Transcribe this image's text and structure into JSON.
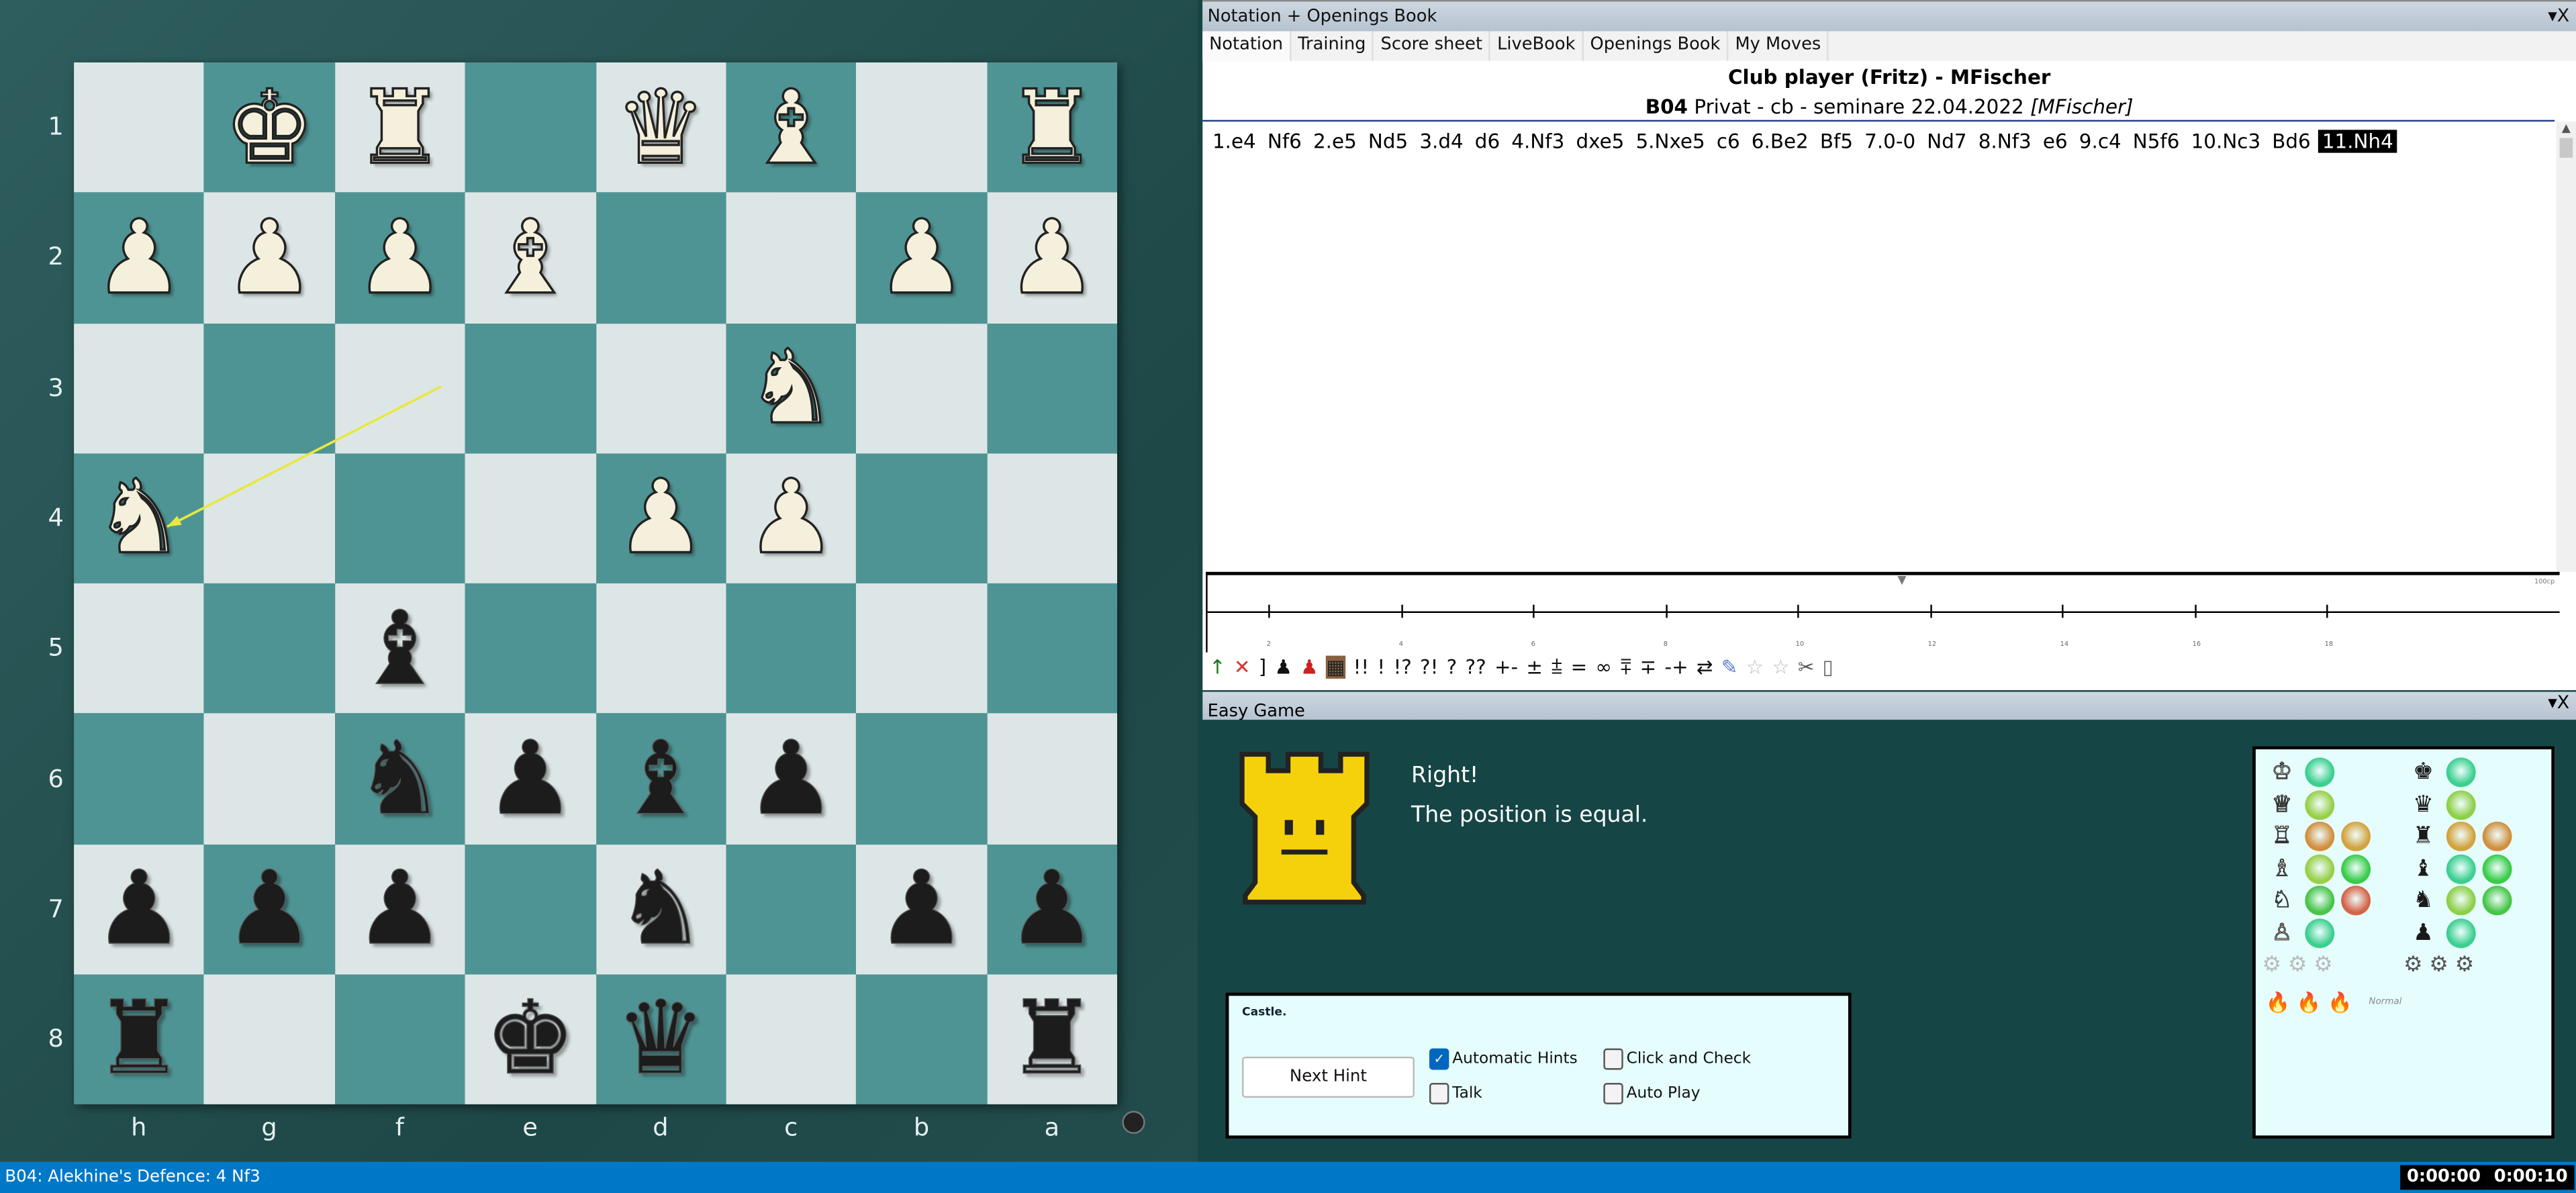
{
  "board": {
    "orientation": "black-bottom",
    "ranks": [
      "1",
      "2",
      "3",
      "4",
      "5",
      "6",
      "7",
      "8"
    ],
    "files": [
      "h",
      "g",
      "f",
      "e",
      "d",
      "c",
      "b",
      "a"
    ],
    "squares": [
      [
        "",
        "K",
        "R",
        "",
        "Q",
        "B",
        "",
        "R"
      ],
      [
        "P",
        "P",
        "P",
        "B",
        "",
        "",
        "P",
        "P"
      ],
      [
        "",
        "",
        "",
        "",
        "",
        "N",
        "",
        ""
      ],
      [
        "N",
        "",
        "",
        "",
        "P",
        "P",
        "",
        ""
      ],
      [
        "",
        "",
        "b",
        "",
        "",
        "",
        "",
        ""
      ],
      [
        "",
        "",
        "n",
        "p",
        "b",
        "p",
        "",
        ""
      ],
      [
        "p",
        "p",
        "p",
        "",
        "n",
        "",
        "p",
        "p"
      ],
      [
        "r",
        "",
        "",
        "k",
        "q",
        "",
        "",
        "r"
      ]
    ],
    "arrow": {
      "from": "f3",
      "to": "h4",
      "color": "#e8e840"
    },
    "light_color": "#dde6e6",
    "dark_color": "#4f9494"
  },
  "notation": {
    "title": "Notation + Openings Book",
    "controls": "▾X",
    "tabs": [
      "Notation",
      "Training",
      "Score sheet",
      "LiveBook",
      "Openings Book",
      "My Moves"
    ],
    "players": "Club player (Fritz) - MFischer",
    "eco": "B04",
    "event": "Privat - cb - seminare 22.04.2022",
    "annotator": "[MFischer]",
    "moves": [
      "1.e4",
      "Nf6",
      "2.e5",
      "Nd5",
      "3.d4",
      "d6",
      "4.Nf3",
      "dxe5",
      "5.Nxe5",
      "c6",
      "6.Be2",
      "Bf5",
      "7.0-0",
      "Nd7",
      "8.Nf3",
      "e6",
      "9.c4",
      "N5f6",
      "10.Nc3",
      "Bd6",
      "11.Nh4"
    ],
    "current_move": "11.Nh4",
    "graph_labels": [
      "2",
      "4",
      "6",
      "8",
      "10",
      "12",
      "14",
      "16",
      "18"
    ],
    "graph_scale": "100cp",
    "annotation_symbols": [
      "!!",
      "!",
      "!?",
      "?!",
      "?",
      "??",
      "+-",
      "±",
      "⩲",
      "=",
      "∞",
      "⩱",
      "∓",
      "-+",
      "⇄"
    ]
  },
  "easy_game": {
    "title": "Easy Game",
    "controls": "▾X",
    "message_title": "Right!",
    "message": "The position is equal.",
    "hint": "Castle.",
    "next_hint_label": "Next Hint",
    "checkboxes": [
      {
        "label": "Automatic Hints",
        "checked": true
      },
      {
        "label": "Click and Check",
        "checked": false
      },
      {
        "label": "Talk",
        "checked": false
      },
      {
        "label": "Auto Play",
        "checked": false
      }
    ],
    "stats": {
      "white": [
        {
          "piece": "♔",
          "balls": [
            "#3ccf8e"
          ]
        },
        {
          "piece": "♕",
          "balls": [
            "#98cf48"
          ]
        },
        {
          "piece": "♖",
          "balls": [
            "#d0903e",
            "#d2a23e"
          ]
        },
        {
          "piece": "♗",
          "balls": [
            "#98cf48",
            "#38cc48"
          ]
        },
        {
          "piece": "♘",
          "balls": [
            "#48c448",
            "#d46448"
          ]
        },
        {
          "piece": "♙",
          "balls": [
            "#3ccf8e"
          ]
        }
      ],
      "black": [
        {
          "piece": "♚",
          "balls": [
            "#3ccf8e"
          ]
        },
        {
          "piece": "♛",
          "balls": [
            "#8ecf48"
          ]
        },
        {
          "piece": "♜",
          "balls": [
            "#d2a23e",
            "#d0903e"
          ]
        },
        {
          "piece": "♝",
          "balls": [
            "#3ccf8e",
            "#38cc48"
          ]
        },
        {
          "piece": "♞",
          "balls": [
            "#8ecf48",
            "#48c448"
          ]
        },
        {
          "piece": "♟",
          "balls": [
            "#3ccf8e"
          ]
        }
      ],
      "level": "Normal"
    }
  },
  "status": {
    "opening": "B04: Alekhine's Defence: 4 Nf3",
    "clock_white": "0:00:00",
    "clock_black": "0:00:10",
    "bar_color": "#0078c8"
  }
}
